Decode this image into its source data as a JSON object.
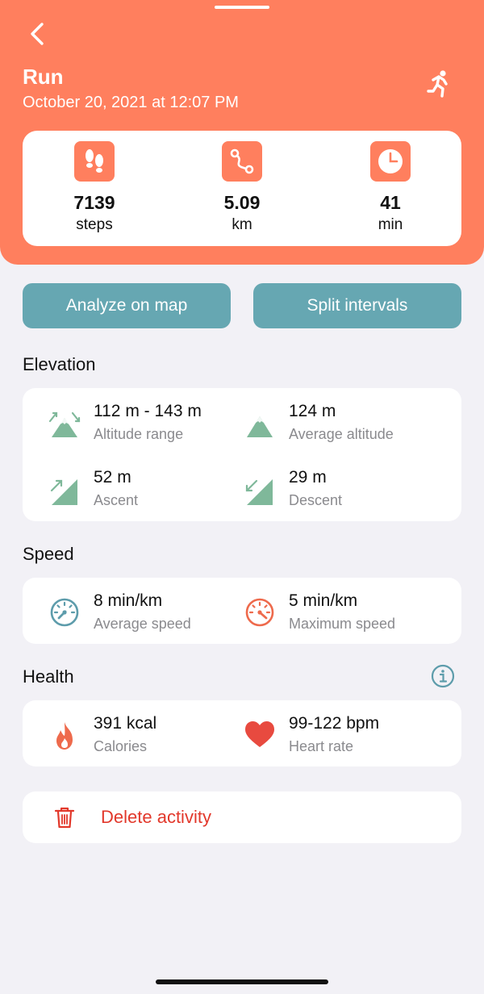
{
  "header": {
    "title": "Run",
    "subtitle": "October 20, 2021 at 12:07 PM",
    "accent_color": "#ff7f5e"
  },
  "stats": [
    {
      "icon": "footsteps-icon",
      "value": "7139",
      "unit": "steps"
    },
    {
      "icon": "route-icon",
      "value": "5.09",
      "unit": "km"
    },
    {
      "icon": "clock-icon",
      "value": "41",
      "unit": "min"
    }
  ],
  "actions": {
    "analyze_label": "Analyze on map",
    "split_label": "Split intervals",
    "button_color": "#66a7b2"
  },
  "elevation": {
    "title": "Elevation",
    "items": [
      {
        "icon": "altitude-range-icon",
        "value": "112 m - 143 m",
        "label": "Altitude range"
      },
      {
        "icon": "mountain-icon",
        "value": "124 m",
        "label": "Average altitude"
      },
      {
        "icon": "ascent-icon",
        "value": "52 m",
        "label": "Ascent"
      },
      {
        "icon": "descent-icon",
        "value": "29 m",
        "label": "Descent"
      }
    ]
  },
  "speed": {
    "title": "Speed",
    "items": [
      {
        "icon": "speedometer-icon",
        "value": "8 min/km",
        "label": "Average speed"
      },
      {
        "icon": "max-speedometer-icon",
        "value": "5 min/km",
        "label": "Maximum speed"
      }
    ]
  },
  "health": {
    "title": "Health",
    "items": [
      {
        "icon": "flame-icon",
        "value": "391 kcal",
        "label": "Calories"
      },
      {
        "icon": "heart-icon",
        "value": "99-122 bpm",
        "label": "Heart rate"
      }
    ]
  },
  "delete": {
    "label": "Delete activity",
    "color": "#e2382b"
  }
}
